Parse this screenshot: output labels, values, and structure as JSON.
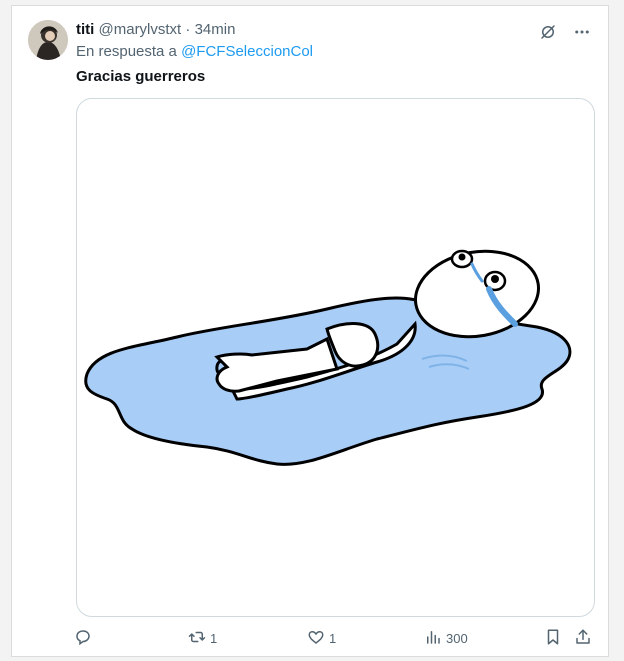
{
  "tweet": {
    "author_name": "titi",
    "handle": "@marylvstxt",
    "separator": "·",
    "time": "34min",
    "reply_prefix": "En respuesta a",
    "reply_to": "@FCFSeleccionCol",
    "text": "Gracias guerreros"
  },
  "actions": {
    "retweets": "1",
    "likes": "1",
    "views": "300"
  },
  "icons": [
    "grok-icon",
    "more-icon",
    "reply-icon",
    "retweet-icon",
    "like-icon",
    "views-icon",
    "bookmark-icon",
    "share-icon"
  ]
}
